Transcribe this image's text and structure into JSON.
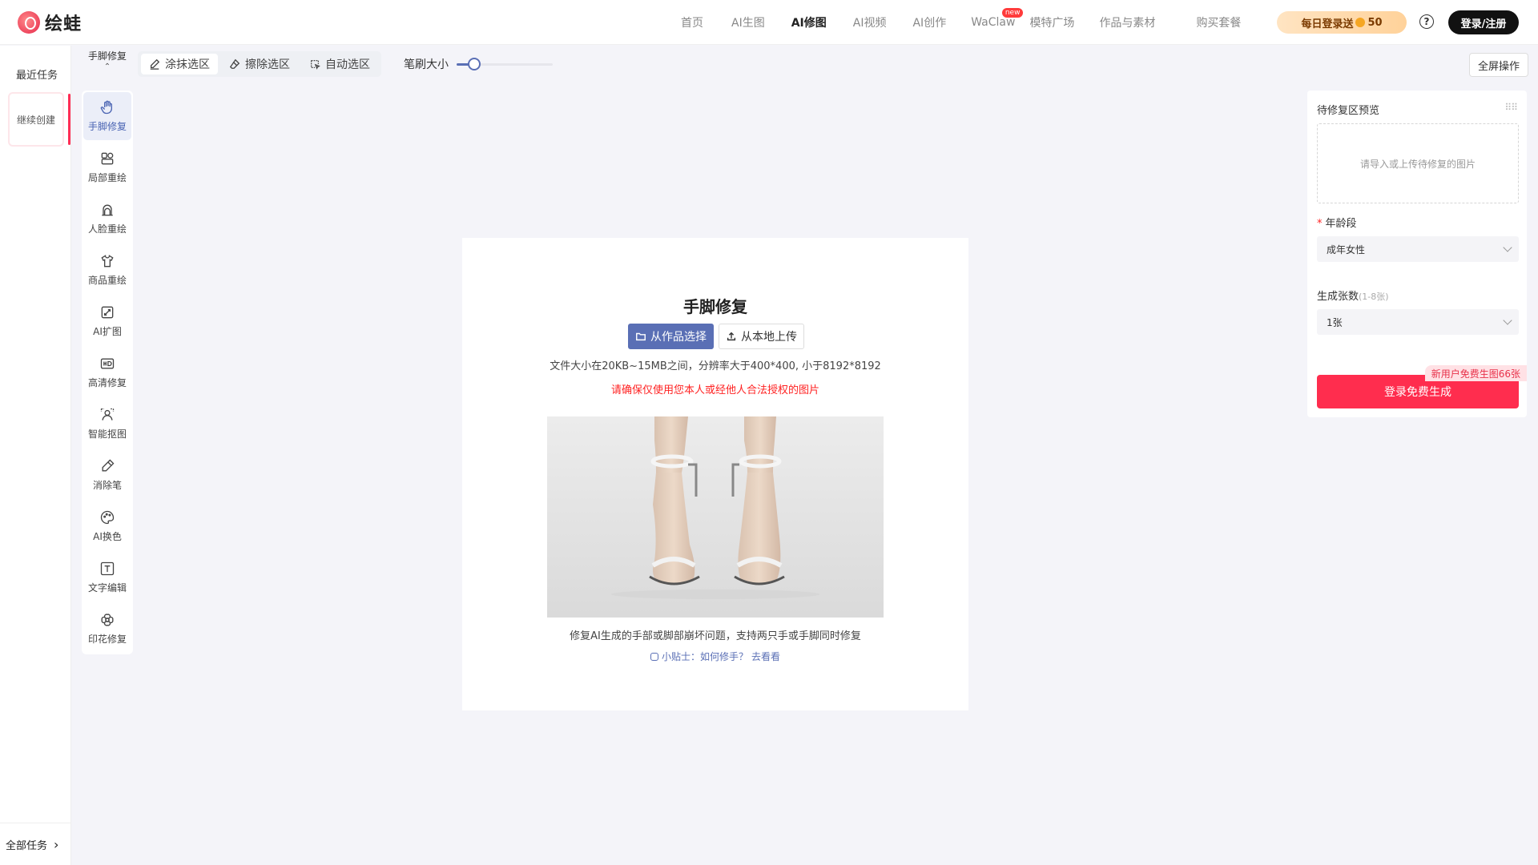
{
  "brand": {
    "name": "绘蛙"
  },
  "nav": {
    "items": [
      {
        "label": "首页",
        "active": false
      },
      {
        "label": "AI生图",
        "active": false
      },
      {
        "label": "AI修图",
        "active": true
      },
      {
        "label": "AI视频",
        "active": false
      },
      {
        "label": "AI创作",
        "active": false
      },
      {
        "label": "WaClaw",
        "active": false,
        "badge": "new"
      },
      {
        "label": "模特广场",
        "active": false
      },
      {
        "label": "作品与素材",
        "active": false
      },
      {
        "label": "购买套餐",
        "active": false
      }
    ],
    "daily_label": "每日登录送",
    "daily_value": "50",
    "help_glyph": "?",
    "login_label": "登录/注册"
  },
  "left_rail": {
    "recent_title": "最近任务",
    "continue_label": "继续创建",
    "all_tasks_label": "全部任务",
    "all_tasks_arrow": "›"
  },
  "tool_sidebar": {
    "header_label": "手脚修复",
    "header_chevron": "⌃",
    "tools": [
      {
        "label": "手脚修复",
        "icon": "hand-icon",
        "active": true
      },
      {
        "label": "局部重绘",
        "icon": "shapes-icon",
        "active": false
      },
      {
        "label": "人脸重绘",
        "icon": "face-icon",
        "active": false
      },
      {
        "label": "商品重绘",
        "icon": "tshirt-icon",
        "active": false
      },
      {
        "label": "AI扩图",
        "icon": "expand-icon",
        "active": false
      },
      {
        "label": "高清修复",
        "icon": "hd-icon",
        "active": false
      },
      {
        "label": "智能抠图",
        "icon": "cutout-icon",
        "active": false
      },
      {
        "label": "消除笔",
        "icon": "pen-icon",
        "active": false
      },
      {
        "label": "AI换色",
        "icon": "palette-icon",
        "active": false
      },
      {
        "label": "文字编辑",
        "icon": "text-icon",
        "active": false
      },
      {
        "label": "印花修复",
        "icon": "flower-icon",
        "active": false
      }
    ]
  },
  "options_bar": {
    "paint_label": "涂抹选区",
    "erase_label": "擦除选区",
    "auto_label": "自动选区",
    "brush_label": "笔刷大小",
    "brush_value": 0.18,
    "fullscreen_label": "全屏操作"
  },
  "center": {
    "title": "手脚修复",
    "select_work_label": "从作品选择",
    "upload_label": "从本地上传",
    "file_note": "文件大小在20KB~15MB之间，分辨率大于400*400, 小于8192*8192",
    "warning": "请确保仅使用您本人或经他人合法授权的图片",
    "description": "修复AI生成的手部或脚部崩坏问题，支持两只手或手脚同时修复",
    "tip_prefix": "小贴士：如何修手？",
    "tip_link": "去看看",
    "accent_color": "#5a6fb5",
    "warning_color": "#ff2222"
  },
  "right_panel": {
    "preview_title": "待修复区预览",
    "drop_placeholder": "请导入或上传待修复的图片",
    "age_label": "年龄段",
    "age_required": "*",
    "age_value": "成年女性",
    "count_label": "生成张数",
    "count_hint": "(1-8张)",
    "count_value": "1张",
    "promo_badge": "新用户免费生图66张",
    "generate_label": "登录免费生成",
    "primary_color": "#ff2d4e"
  }
}
